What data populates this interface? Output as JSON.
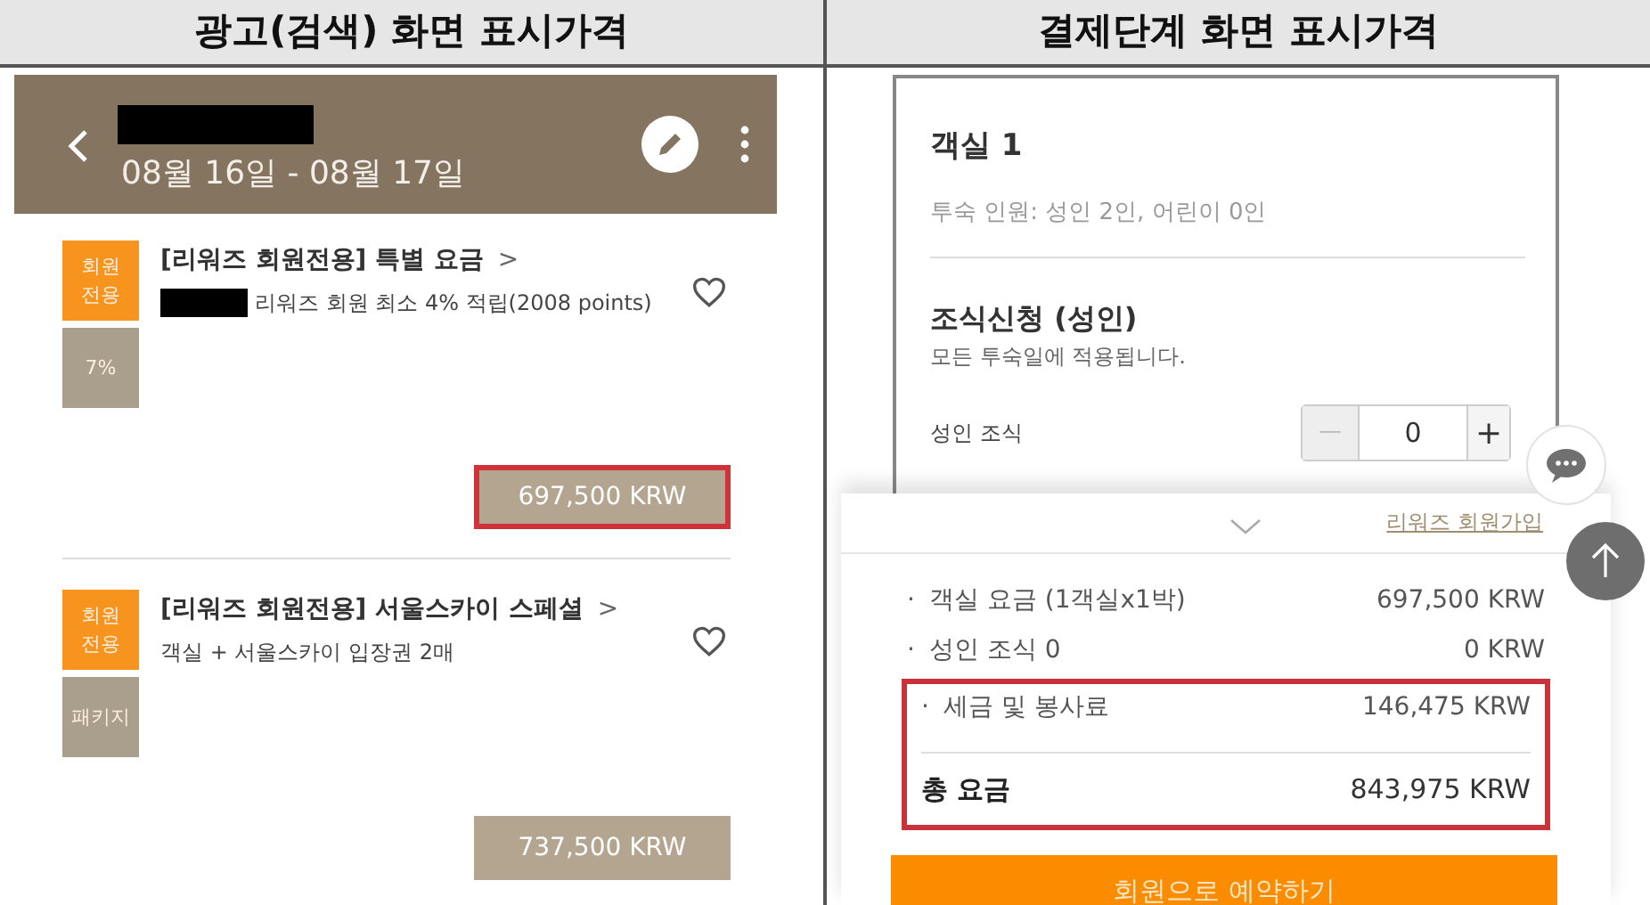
{
  "panels": [
    {
      "title": "광고(검색) 화면 표시가격"
    },
    {
      "title": "결제단계 화면 표시가격"
    }
  ],
  "search_screen": {
    "header": {
      "dates": "08월 16일 - 08월 17일"
    },
    "offers": [
      {
        "title": "[리워즈 회원전용] 특별 요금",
        "chevron": ">",
        "subtitle": "리워즈 회원 최소 4% 적립(2008 points)",
        "redacted": true,
        "badges": [
          {
            "text": "회원 전용",
            "color": "#f7941d"
          },
          {
            "text": "7%",
            "color": "#aa9e8c"
          }
        ],
        "price": "697,500 KRW",
        "highlighted": true
      },
      {
        "title": "[리워즈 회원전용] 서울스카이 스페셜",
        "chevron": ">",
        "subtitle": "객실 + 서울스카이 입장권 2매",
        "redacted": false,
        "badges": [
          {
            "text": "회원 전용",
            "color": "#f7941d"
          },
          {
            "text": "패키지",
            "color": "#aa9e8c"
          }
        ],
        "price": "737,500 KRW",
        "highlighted": false
      }
    ]
  },
  "checkout_screen": {
    "room_title": "객실 1",
    "guests": "투숙 인원: 성인 2인, 어린이 0인",
    "breakfast_title": "조식신청 (성인)",
    "breakfast_note": "모든 투숙일에 적용됩니다.",
    "stepper": {
      "label": "성인 조식",
      "minus": "—",
      "value": "0",
      "plus": "+"
    },
    "signup_link": "리워즈 회원가입",
    "rows": [
      {
        "bullet": "·",
        "label": "객실 요금 (1객실x1박)",
        "value": "697,500 KRW"
      },
      {
        "bullet": "·",
        "label": "성인 조식 0",
        "value": "0 KRW"
      }
    ],
    "highlighted_group": {
      "highlighted": true,
      "rows": [
        {
          "bullet": "·",
          "label": "세금 및 봉사료",
          "value": "146,475 KRW"
        }
      ],
      "total": {
        "label": "총 요금",
        "value": "843,975 KRW"
      }
    },
    "book_button": "회원으로 예약하기"
  }
}
